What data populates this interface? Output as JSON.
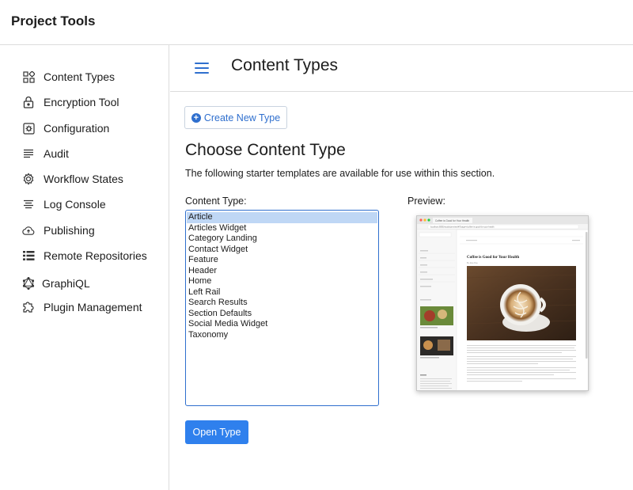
{
  "app": {
    "title": "Project Tools"
  },
  "sidebar": {
    "items": [
      {
        "label": "Content Types",
        "icon": "content-types-icon"
      },
      {
        "label": "Encryption Tool",
        "icon": "lock-icon"
      },
      {
        "label": "Configuration",
        "icon": "gear-box-icon"
      },
      {
        "label": "Audit",
        "icon": "list-lines-icon"
      },
      {
        "label": "Workflow States",
        "icon": "gear-icon"
      },
      {
        "label": "Log Console",
        "icon": "log-lines-icon"
      },
      {
        "label": "Publishing",
        "icon": "cloud-upload-icon"
      },
      {
        "label": "Remote Repositories",
        "icon": "list-bullets-icon"
      },
      {
        "label": "GraphiQL",
        "icon": "graphql-icon"
      },
      {
        "label": "Plugin Management",
        "icon": "puzzle-icon"
      }
    ]
  },
  "main": {
    "title": "Content Types",
    "create_button": "Create New Type",
    "heading": "Choose Content Type",
    "description": "The following starter templates are available for use within this section.",
    "content_type_label": "Content Type:",
    "preview_label": "Preview:",
    "content_types": [
      "Article",
      "Articles Widget",
      "Category Landing",
      "Contact Widget",
      "Feature",
      "Header",
      "Home",
      "Left Rail",
      "Search Results",
      "Section Defaults",
      "Social Media Widget",
      "Taxonomy"
    ],
    "selected": "Article",
    "open_button": "Open Type"
  },
  "preview": {
    "tab_title": "Coffee is Good for Your Health",
    "url": "localhost:8080/studio/preview/#/?page=/coffee-is-good-for-your-health",
    "article_title": "Coffee is Good for Your Health",
    "byline": "By Jane Doe"
  },
  "colors": {
    "accent": "#2f6fce",
    "button": "#2f80ed",
    "selected": "#bfd7f5"
  }
}
